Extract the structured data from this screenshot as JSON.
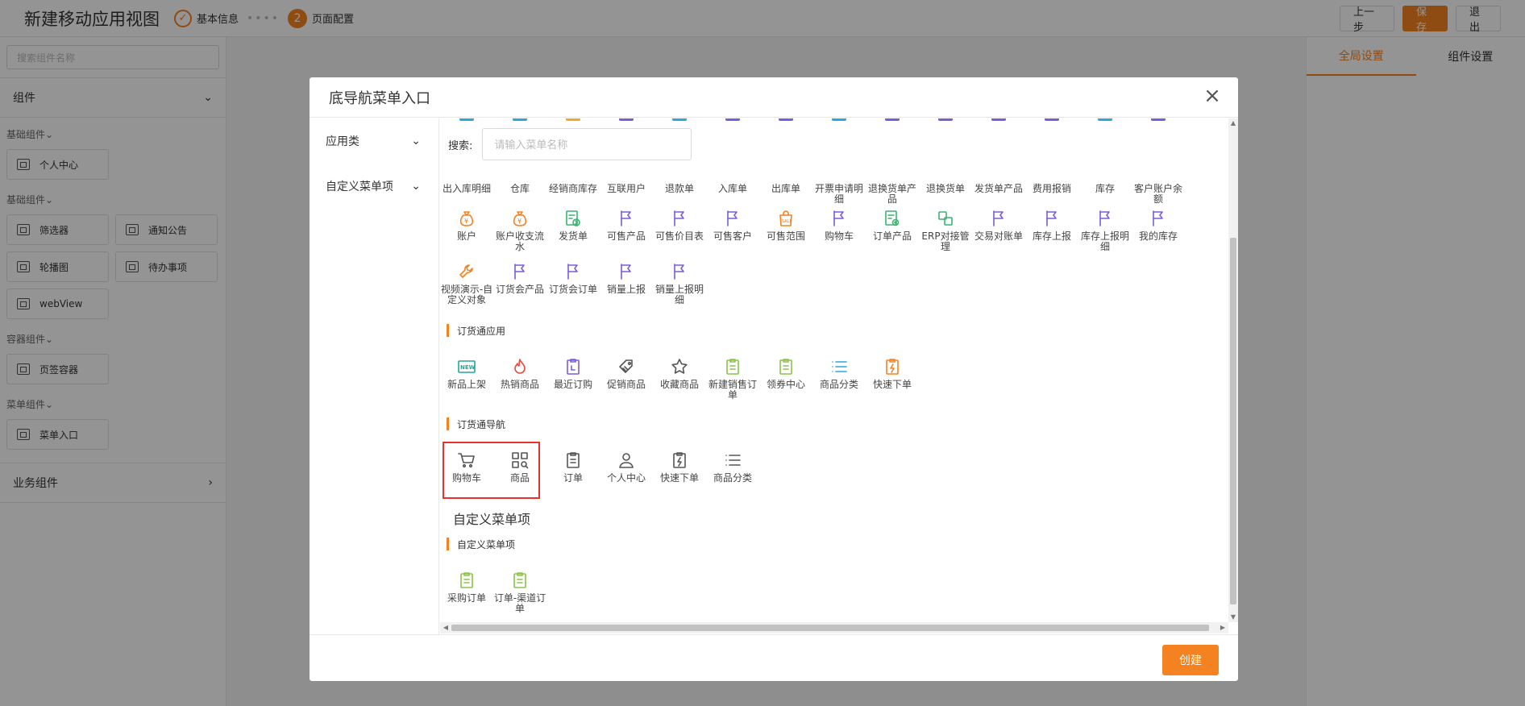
{
  "app": {
    "title": "新建移动应用视图",
    "steps": [
      {
        "label": "基本信息",
        "state": "done"
      },
      {
        "num": "2",
        "label": "页面配置",
        "state": "active"
      }
    ],
    "buttons": {
      "prev": "上一步",
      "save": "保存",
      "exit": "退出"
    },
    "accent": "#f58220"
  },
  "sidebar": {
    "search_placeholder": "搜索组件名称",
    "panel_title": "组件",
    "groups": [
      {
        "label": "基础组件",
        "items": [
          "个人中心"
        ]
      },
      {
        "label": "基础组件",
        "items": [
          "筛选器",
          "通知公告",
          "轮播图",
          "待办事项",
          "webView"
        ]
      },
      {
        "label": "容器组件",
        "items": [
          "页签容器"
        ]
      },
      {
        "label": "菜单组件",
        "items": [
          "菜单入口"
        ]
      }
    ],
    "biz_title": "业务组件"
  },
  "rightpanel": {
    "tabs": [
      "全局设置",
      "组件设置"
    ]
  },
  "modal": {
    "title": "底导航菜单入口",
    "close": "×",
    "left_menu": [
      "应用类",
      "自定义菜单项"
    ],
    "search_label": "搜索:",
    "search_placeholder": "请输入菜单名称",
    "row1": [
      {
        "label": "出入库明细",
        "icon": "box",
        "color": "#2aa8d9"
      },
      {
        "label": "仓库",
        "icon": "warehouse",
        "color": "#2aa8d9"
      },
      {
        "label": "经销商库存",
        "icon": "stock",
        "color": "#f5a623"
      },
      {
        "label": "互联用户",
        "icon": "user",
        "color": "#7b5cd6"
      },
      {
        "label": "退款单",
        "icon": "refund",
        "color": "#2aa8d9"
      },
      {
        "label": "入库单",
        "icon": "flag",
        "color": "#7b5cd6"
      },
      {
        "label": "出库单",
        "icon": "flag",
        "color": "#7b5cd6"
      },
      {
        "label": "开票申请明细",
        "icon": "doc",
        "color": "#2aa8d9"
      },
      {
        "label": "退换货单产品",
        "icon": "flag",
        "color": "#7b5cd6"
      },
      {
        "label": "退换货单",
        "icon": "flag",
        "color": "#7b5cd6"
      },
      {
        "label": "发货单产品",
        "icon": "flag",
        "color": "#7b5cd6"
      },
      {
        "label": "费用报销",
        "icon": "flag",
        "color": "#7b5cd6"
      },
      {
        "label": "库存",
        "icon": "doc",
        "color": "#2aa8d9"
      },
      {
        "label": "客户账户余额",
        "icon": "flag",
        "color": "#7b5cd6"
      }
    ],
    "row2": [
      {
        "label": "账户",
        "icon": "money-bag",
        "color": "#f58220"
      },
      {
        "label": "账户收支流水",
        "icon": "money-bag",
        "color": "#f58220"
      },
      {
        "label": "发货单",
        "icon": "doc-go",
        "color": "#3cb371"
      },
      {
        "label": "可售产品",
        "icon": "flag",
        "color": "#7b5cd6"
      },
      {
        "label": "可售价目表",
        "icon": "flag",
        "color": "#7b5cd6"
      },
      {
        "label": "可售客户",
        "icon": "flag",
        "color": "#7b5cd6"
      },
      {
        "label": "可售范围",
        "icon": "sale-bag",
        "color": "#f58220"
      },
      {
        "label": "购物车",
        "icon": "flag",
        "color": "#7b5cd6"
      },
      {
        "label": "订单产品",
        "icon": "doc-gear",
        "color": "#3cb371"
      },
      {
        "label": "ERP对接管理",
        "icon": "link",
        "color": "#3cb371"
      },
      {
        "label": "交易对账单",
        "icon": "flag",
        "color": "#7b5cd6"
      },
      {
        "label": "库存上报",
        "icon": "flag",
        "color": "#7b5cd6"
      },
      {
        "label": "库存上报明细",
        "icon": "flag",
        "color": "#7b5cd6"
      },
      {
        "label": "我的库存",
        "icon": "flag",
        "color": "#7b5cd6"
      }
    ],
    "row3": [
      {
        "label": "视频演示-自定义对象",
        "icon": "wrench",
        "color": "#f58220"
      },
      {
        "label": "订货会产品",
        "icon": "flag",
        "color": "#7b5cd6"
      },
      {
        "label": "订货会订单",
        "icon": "flag",
        "color": "#7b5cd6"
      },
      {
        "label": "销量上报",
        "icon": "flag",
        "color": "#7b5cd6"
      },
      {
        "label": "销量上报明细",
        "icon": "flag",
        "color": "#7b5cd6"
      }
    ],
    "section1": "订货通应用",
    "row4": [
      {
        "label": "新品上架",
        "icon": "new",
        "color": "#26a69a"
      },
      {
        "label": "热销商品",
        "icon": "fire",
        "color": "#e84a3b"
      },
      {
        "label": "最近订购",
        "icon": "recent",
        "color": "#7b5cd6"
      },
      {
        "label": "促销商品",
        "icon": "tag",
        "color": "#555555"
      },
      {
        "label": "收藏商品",
        "icon": "star",
        "color": "#555555"
      },
      {
        "label": "新建销售订单",
        "icon": "doc",
        "color": "#8bc34a"
      },
      {
        "label": "领券中心",
        "icon": "doc",
        "color": "#8bc34a"
      },
      {
        "label": "商品分类",
        "icon": "list",
        "color": "#2aa8d9"
      },
      {
        "label": "快速下单",
        "icon": "quick",
        "color": "#f58220"
      }
    ],
    "section2": "订货通导航",
    "row5": [
      {
        "label": "购物车",
        "icon": "cart",
        "color": "#555555"
      },
      {
        "label": "商品",
        "icon": "grid-search",
        "color": "#555555"
      },
      {
        "label": "订单",
        "icon": "doc",
        "color": "#555555"
      },
      {
        "label": "个人中心",
        "icon": "person",
        "color": "#555555"
      },
      {
        "label": "快速下单",
        "icon": "quick",
        "color": "#555555"
      },
      {
        "label": "商品分类",
        "icon": "list",
        "color": "#555555"
      }
    ],
    "custom_title": "自定义菜单项",
    "section3": "自定义菜单项",
    "row6": [
      {
        "label": "采购订单",
        "icon": "doc",
        "color": "#8bc34a"
      },
      {
        "label": "订单-渠道订单",
        "icon": "doc",
        "color": "#8bc34a"
      }
    ],
    "create": "创建"
  }
}
